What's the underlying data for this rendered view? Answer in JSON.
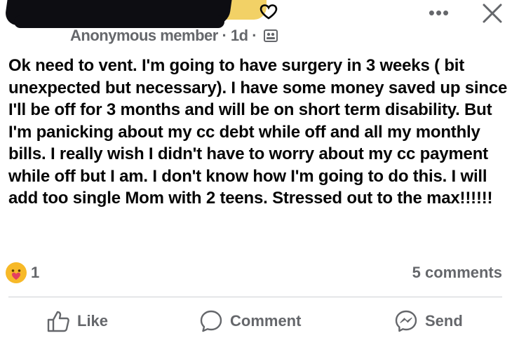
{
  "header": {
    "author_line": "Anonymous member",
    "separator": " · ",
    "time": "1d",
    "dot": " ·",
    "badge_icons": "♡",
    "more_label": "•••"
  },
  "post": {
    "text": "Ok need to vent. I'm going to have surgery in 3 weeks ( bit unexpected but necessary). I have some money saved up since I'll be off for 3 months and will be on short term disability. But I'm panicking about my cc debt while off and all my monthly bills. I really wish I didn't have to worry about my cc payment while off but I am. I don't know how I'm going to do this. I will add too single Mom with 2 teens. Stressed out to the max!!!!!!"
  },
  "reactions": {
    "icon": "care-reaction",
    "count": "1",
    "comments": "5 comments"
  },
  "actions": {
    "like": "Like",
    "comment": "Comment",
    "send": "Send"
  },
  "colors": {
    "secondary_text": "#65676b",
    "reaction_yellow": "#f7b928",
    "divider": "#ced0d4"
  }
}
